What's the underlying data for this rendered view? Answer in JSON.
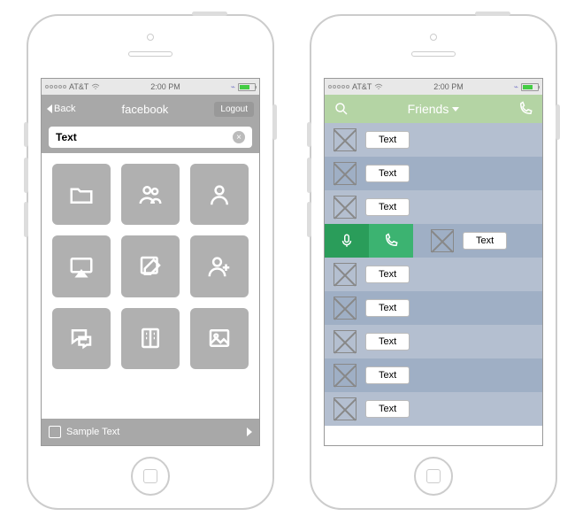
{
  "statusbar": {
    "carrier": "AT&T",
    "time": "2:00 PM"
  },
  "left": {
    "nav": {
      "back": "Back",
      "title": "facebook",
      "logout": "Logout"
    },
    "search": {
      "value": "Text"
    },
    "footer": {
      "text": "Sample Text"
    }
  },
  "right": {
    "nav": {
      "title": "Friends"
    },
    "rows": [
      {
        "label": "Text"
      },
      {
        "label": "Text"
      },
      {
        "label": "Text"
      },
      {
        "label": "Text",
        "swipe": true
      },
      {
        "label": "Text"
      },
      {
        "label": "Text"
      },
      {
        "label": "Text"
      },
      {
        "label": "Text"
      },
      {
        "label": "Text"
      }
    ]
  }
}
